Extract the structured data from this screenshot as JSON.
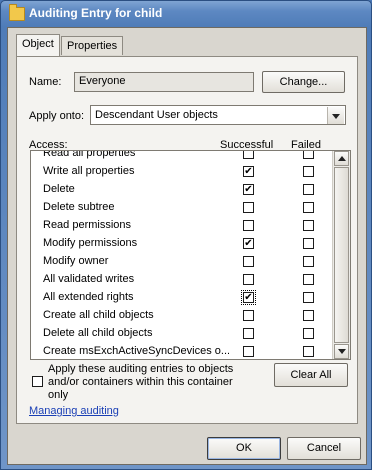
{
  "window": {
    "title": "Auditing Entry for child"
  },
  "tabs": [
    {
      "label": "Object",
      "active": true
    },
    {
      "label": "Properties",
      "active": false
    }
  ],
  "name_row": {
    "label": "Name:",
    "value": "Everyone",
    "change_button": "Change..."
  },
  "apply_onto": {
    "label": "Apply onto:",
    "selected": "Descendant User objects"
  },
  "access_headers": {
    "access": "Access:",
    "successful": "Successful",
    "failed": "Failed"
  },
  "access_rows": [
    {
      "name": "Read all properties",
      "successful": false,
      "failed": false
    },
    {
      "name": "Write all properties",
      "successful": true,
      "failed": false
    },
    {
      "name": "Delete",
      "successful": true,
      "failed": false
    },
    {
      "name": "Delete subtree",
      "successful": false,
      "failed": false
    },
    {
      "name": "Read permissions",
      "successful": false,
      "failed": false
    },
    {
      "name": "Modify permissions",
      "successful": true,
      "failed": false
    },
    {
      "name": "Modify owner",
      "successful": false,
      "failed": false
    },
    {
      "name": "All validated writes",
      "successful": false,
      "failed": false
    },
    {
      "name": "All extended rights",
      "successful": true,
      "failed": false
    },
    {
      "name": "Create all child objects",
      "successful": false,
      "failed": false
    },
    {
      "name": "Delete all child objects",
      "successful": false,
      "failed": false
    },
    {
      "name": "Create msExchActiveSyncDevices o...",
      "successful": false,
      "failed": false
    }
  ],
  "apply_checkbox": {
    "lines": [
      "Apply these auditing entries to objects",
      "and/or containers within this container",
      "only"
    ],
    "checked": false
  },
  "clear_all_button": "Clear All",
  "managing_link": "Managing auditing",
  "footer": {
    "ok": "OK",
    "cancel": "Cancel"
  },
  "colors": {
    "titlebar": "#4f7cb8",
    "dialog_bg": "#d9d6cf",
    "link": "#1a3fb5"
  }
}
